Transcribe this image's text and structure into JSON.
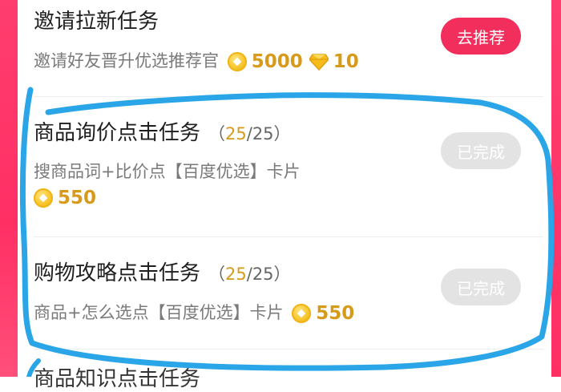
{
  "tasks": [
    {
      "title": "邀请拉新任务",
      "desc": "邀请好友晋升优选推荐官",
      "coin_reward": "5000",
      "gem_reward": "10",
      "button": "去推荐"
    },
    {
      "title": "商品询价点击任务",
      "progress_done": "25",
      "progress_total": "/25",
      "progress_open": "（",
      "progress_close": "）",
      "desc": "搜商品词+比价点【百度优选】卡片",
      "coin_reward": "550",
      "button": "已完成"
    },
    {
      "title": "购物攻略点击任务",
      "progress_done": "25",
      "progress_total": "/25",
      "progress_open": "（",
      "progress_close": "）",
      "desc": "商品+怎么选点【百度优选】卡片",
      "coin_reward": "550",
      "button": "已完成"
    }
  ],
  "next_task_peek": "商品知识点击任务",
  "colors": {
    "accent": "#f22f5c",
    "reward": "#d79a1a",
    "annotation": "#2aa6e8",
    "disabled": "#e3e3e3"
  },
  "icons": [
    "coin-icon",
    "diamond-icon"
  ]
}
